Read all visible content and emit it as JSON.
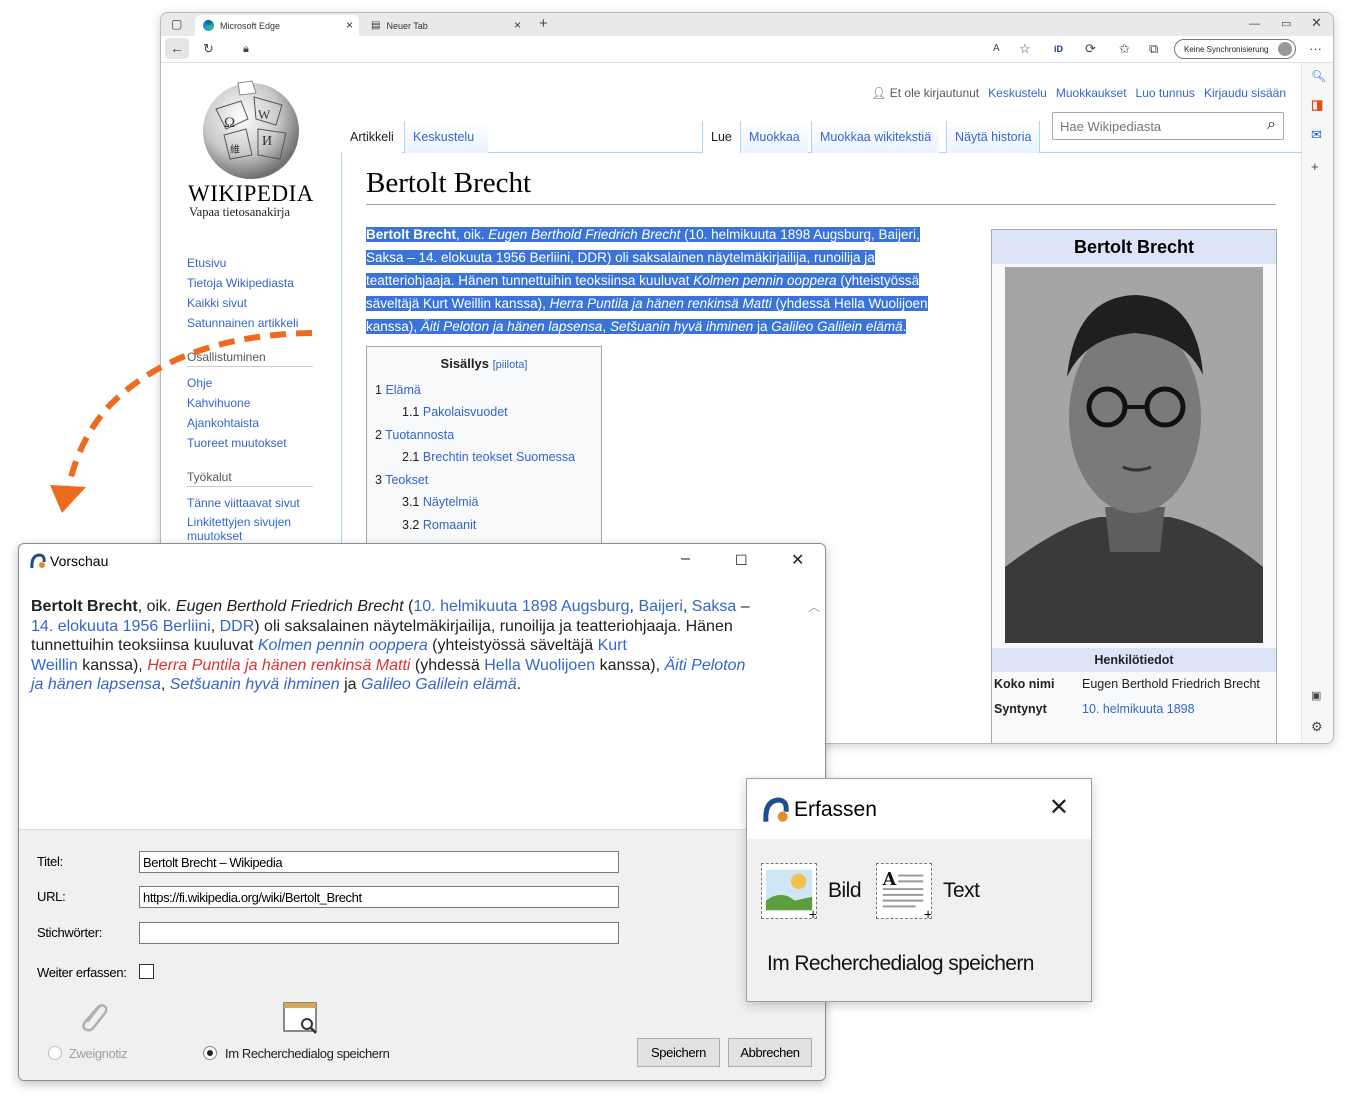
{
  "browser": {
    "tabs": [
      {
        "label": "Microsoft Edge",
        "active": true
      },
      {
        "label": "Neuer Tab",
        "active": false
      }
    ],
    "sync_label": "Keine Synchronisierung",
    "accent": "#3366cc"
  },
  "wiki": {
    "wordmark": "WIKIPEDIA",
    "tagline": "Vapaa tietosanakirja",
    "nav_main": [
      "Etusivu",
      "Tietoja Wikipediasta",
      "Kaikki sivut",
      "Satunnainen artikkeli"
    ],
    "nav_participation_heading": "Osallistuminen",
    "nav_participation": [
      "Ohje",
      "Kahvihuone",
      "Ajankohtaista",
      "Tuoreet muutokset"
    ],
    "nav_tools_heading": "Työkalut",
    "nav_tools": [
      "Tänne viittaavat sivut",
      "Linkitettyjen sivujen",
      "muutokset"
    ],
    "personal": {
      "not_logged_in": "Et ole kirjautunut",
      "links": [
        "Keskustelu",
        "Muokkaukset",
        "Luo tunnus",
        "Kirjaudu sisään"
      ]
    },
    "tabs_left": [
      "Artikkeli",
      "Keskustelu"
    ],
    "tabs_right": [
      "Lue",
      "Muokkaa",
      "Muokkaa wikitekstiä",
      "Näytä historia"
    ],
    "search_placeholder": "Hae Wikipediasta",
    "heading": "Bertolt Brecht",
    "lead_lines": [
      {
        "b": "Bertolt Brecht",
        "t1": ", oik. ",
        "i": "Eugen Berthold Friedrich Brecht",
        "t2": " (10. helmikuuta 1898 Augsburg, Baijeri,"
      },
      {
        "t": "Saksa – 14. elokuuta 1956 Berliini, DDR) oli saksalainen näytelmäkirjailija, runoilija ja"
      },
      {
        "t": "teatteriohjaaja. Hänen tunnettuihin teoksiinsa kuuluvat ",
        "i": "Kolmen pennin ooppera",
        "t2": " (yhteistyössä"
      },
      {
        "t": "säveltäjä Kurt Weillin kanssa), ",
        "i": "Herra Puntila ja hänen renkinsä Matti",
        "t2": " (yhdessä Hella Wuolijoen"
      },
      {
        "t": "kanssa), ",
        "i": "Äiti Peloton ja hänen lapsensa",
        "t2": ", ",
        "i2": "Setšuanin hyvä ihminen",
        "t3": " ja ",
        "i3": "Galileo Galilein elämä",
        "t4": "."
      }
    ],
    "toc": {
      "title": "Sisällys",
      "hide": "[piilota]",
      "items": [
        {
          "num": "1",
          "label": "Elämä",
          "level": 1
        },
        {
          "num": "1.1",
          "label": "Pakolaisvuodet",
          "level": 2
        },
        {
          "num": "2",
          "label": "Tuotannosta",
          "level": 1
        },
        {
          "num": "2.1",
          "label": "Brechtin teokset Suomessa",
          "level": 2
        },
        {
          "num": "3",
          "label": "Teokset",
          "level": 1
        },
        {
          "num": "3.1",
          "label": "Näytelmiä",
          "level": 2
        },
        {
          "num": "3.2",
          "label": "Romaanit",
          "level": 2
        }
      ]
    },
    "infobox": {
      "title": "Bertolt Brecht",
      "subheading": "Henkilötiedot",
      "rows": [
        {
          "label": "Koko nimi",
          "value": "Eugen Berthold Friedrich Brecht"
        },
        {
          "label": "Syntynyt",
          "value": "10. helmikuuta 1898"
        }
      ]
    }
  },
  "vorschau": {
    "title": "Vorschau",
    "text_lines": [
      [
        {
          "s": "b",
          "v": "Bertolt Brecht"
        },
        {
          "s": "n",
          "v": ", oik. "
        },
        {
          "s": "i",
          "v": "Eugen Berthold Friedrich Brecht"
        },
        {
          "s": "n",
          "v": " ("
        },
        {
          "s": "bl",
          "v": "10. helmikuuta"
        },
        {
          "s": "n",
          "v": " "
        },
        {
          "s": "bl",
          "v": "1898"
        },
        {
          "s": "n",
          "v": " "
        },
        {
          "s": "bl",
          "v": "Augsburg"
        },
        {
          "s": "n",
          "v": ", "
        },
        {
          "s": "bl",
          "v": "Baijeri"
        },
        {
          "s": "n",
          "v": ", "
        },
        {
          "s": "bl",
          "v": "Saksa"
        },
        {
          "s": "n",
          "v": " –"
        }
      ],
      [
        {
          "s": "n",
          "v": " "
        },
        {
          "s": "bl",
          "v": "14. elokuuta"
        },
        {
          "s": "n",
          "v": " "
        },
        {
          "s": "bl",
          "v": "1956"
        },
        {
          "s": "n",
          "v": " "
        },
        {
          "s": "bl",
          "v": "Berliini"
        },
        {
          "s": "n",
          "v": ", "
        },
        {
          "s": "bl",
          "v": "DDR"
        },
        {
          "s": "n",
          "v": ") oli saksalainen näytelmäkirjailija, runoilija ja teatteriohjaaja. Hänen"
        }
      ],
      [
        {
          "s": "n",
          "v": "tunnettuihin teoksiinsa kuuluvat "
        },
        {
          "s": "ibl",
          "v": "Kolmen pennin ooppera"
        },
        {
          "s": "n",
          "v": " (yhteistyössä säveltäjä "
        },
        {
          "s": "bl",
          "v": "Kurt"
        }
      ],
      [
        {
          "s": "bl",
          "v": "Weillin"
        },
        {
          "s": "n",
          "v": " kanssa), "
        },
        {
          "s": "ird",
          "v": "Herra Puntila ja hänen renkinsä Matti"
        },
        {
          "s": "n",
          "v": " (yhdessä "
        },
        {
          "s": "bl",
          "v": "Hella Wuolijoen"
        },
        {
          "s": "n",
          "v": " kanssa), "
        },
        {
          "s": "ibl",
          "v": "Äiti Peloton"
        }
      ],
      [
        {
          "s": "ibl",
          "v": "ja hänen lapsensa"
        },
        {
          "s": "n",
          "v": ", "
        },
        {
          "s": "ibl",
          "v": "Setšuanin hyvä ihminen"
        },
        {
          "s": "n",
          "v": " ja "
        },
        {
          "s": "ibl",
          "v": "Galileo Galilein elämä"
        },
        {
          "s": "n",
          "v": "."
        }
      ]
    ],
    "form": {
      "title_label": "Titel:",
      "title_value": "Bertolt Brecht – Wikipedia",
      "url_label": "URL:",
      "url_value": "https://fi.wikipedia.org/wiki/Bertolt_Brecht",
      "keywords_label": "Stichwörter:",
      "keywords_value": "",
      "continue_label": "Weiter erfassen:",
      "continue_checked": false,
      "radio_branch": "Zweignotiz",
      "radio_research": "Im Recherchedialog speichern",
      "radio_selected": "research",
      "save_button": "Speichern",
      "cancel_button": "Abbrechen"
    }
  },
  "erfassen": {
    "title": "Erfassen",
    "image_label": "Bild",
    "text_label": "Text",
    "save_label": "Im Recherchedialog speichern"
  }
}
